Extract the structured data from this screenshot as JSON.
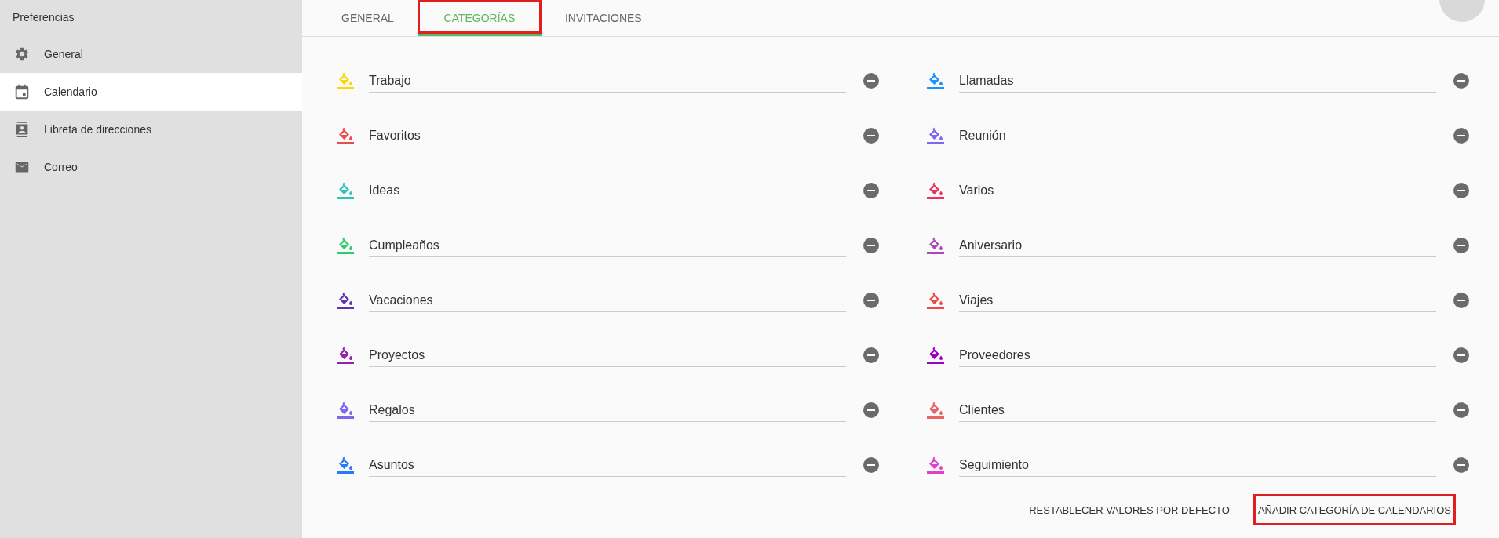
{
  "sidebar": {
    "title": "Preferencias",
    "items": [
      {
        "label": "General",
        "selected": false
      },
      {
        "label": "Calendario",
        "selected": true
      },
      {
        "label": "Libreta de direcciones",
        "selected": false
      },
      {
        "label": "Correo",
        "selected": false
      }
    ]
  },
  "tabs": [
    {
      "label": "GENERAL",
      "selected": false,
      "highlighted": false
    },
    {
      "label": "CATEGORÍAS",
      "selected": true,
      "highlighted": true
    },
    {
      "label": "INVITACIONES",
      "selected": false,
      "highlighted": false
    }
  ],
  "categories": [
    {
      "name": "Trabajo",
      "color": "#ffd600"
    },
    {
      "name": "Llamadas",
      "color": "#1e90ff"
    },
    {
      "name": "Favoritos",
      "color": "#e84c4c"
    },
    {
      "name": "Reunión",
      "color": "#7b68ee"
    },
    {
      "name": "Ideas",
      "color": "#2ec4b6"
    },
    {
      "name": "Varios",
      "color": "#f0325a"
    },
    {
      "name": "Cumpleaños",
      "color": "#2ecc71"
    },
    {
      "name": "Aniversario",
      "color": "#ab47bc"
    },
    {
      "name": "Vacaciones",
      "color": "#5e35b1"
    },
    {
      "name": "Viajes",
      "color": "#f04848"
    },
    {
      "name": "Proyectos",
      "color": "#8e24aa"
    },
    {
      "name": "Proveedores",
      "color": "#9c00c8"
    },
    {
      "name": "Regalos",
      "color": "#7b68ee"
    },
    {
      "name": "Clientes",
      "color": "#e86464"
    },
    {
      "name": "Asuntos",
      "color": "#2979ff"
    },
    {
      "name": "Seguimiento",
      "color": "#e040d0"
    }
  ],
  "buttons": [
    {
      "label": "RESTABLECER VALORES POR DEFECTO",
      "highlighted": false
    },
    {
      "label": "AÑADIR CATEGORÍA DE CALENDARIOS",
      "highlighted": true
    }
  ]
}
